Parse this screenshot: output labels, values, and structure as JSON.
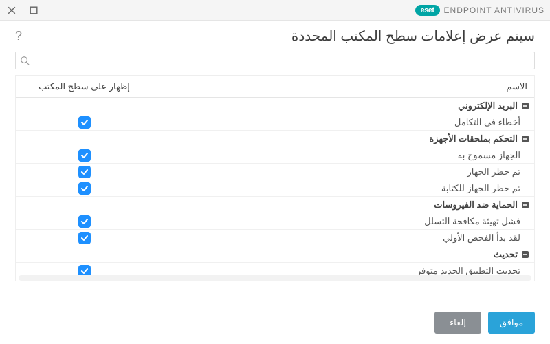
{
  "brand": {
    "badge": "eset",
    "product": "ENDPOINT ANTIVIRUS"
  },
  "header": {
    "title": "سيتم عرض إعلامات سطح المكتب المحددة"
  },
  "columns": {
    "name": "الاسم",
    "show": "إظهار على سطح المكتب"
  },
  "groups": [
    {
      "label": "البريد الإلكتروني",
      "items": [
        {
          "label": "أخطاء في التكامل",
          "checked": true
        }
      ]
    },
    {
      "label": "التحكم بملحقات الأجهزة",
      "items": [
        {
          "label": "الجهاز مسموح به",
          "checked": true
        },
        {
          "label": "تم حظر الجهاز",
          "checked": true
        },
        {
          "label": "تم حظر الجهاز للكتابة",
          "checked": true
        }
      ]
    },
    {
      "label": "الحماية ضد الفيروسات",
      "items": [
        {
          "label": "فشل تهيئة مكافحة التسلل",
          "checked": true
        },
        {
          "label": "لقد بدأ الفحص الأولي",
          "checked": true
        }
      ]
    },
    {
      "label": "تحديث",
      "items": [
        {
          "label": "تحديث التطبيق الجديد متوفر",
          "checked": true
        }
      ]
    }
  ],
  "footer": {
    "ok": "موافق",
    "cancel": "إلغاء"
  }
}
